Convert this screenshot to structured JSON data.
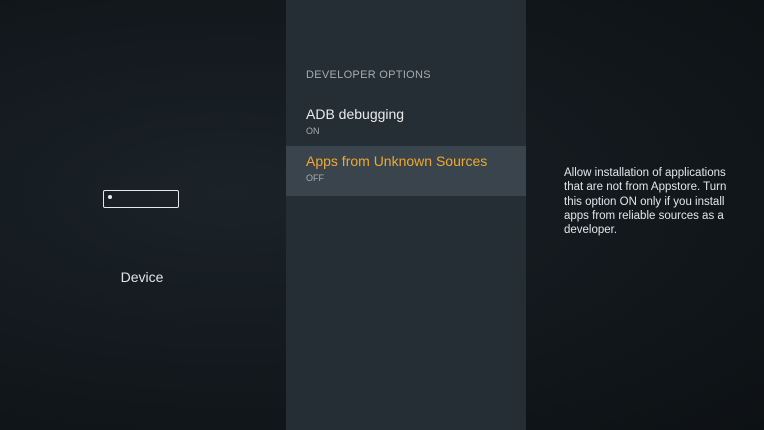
{
  "left_pane": {
    "icon": "device-icon",
    "label": "Device"
  },
  "middle_pane": {
    "section_header": "DEVELOPER OPTIONS",
    "items": [
      {
        "title": "ADB debugging",
        "value": "ON",
        "selected": false
      },
      {
        "title": "Apps from Unknown Sources",
        "value": "OFF",
        "selected": true
      }
    ]
  },
  "right_pane": {
    "description": "Allow installation of applications that are not from Appstore. Turn this option ON only if you install apps from reliable sources as a developer."
  },
  "colors": {
    "accent": "#f0a831",
    "selected_background": "#3a444c",
    "middle_background": "#252e35"
  }
}
